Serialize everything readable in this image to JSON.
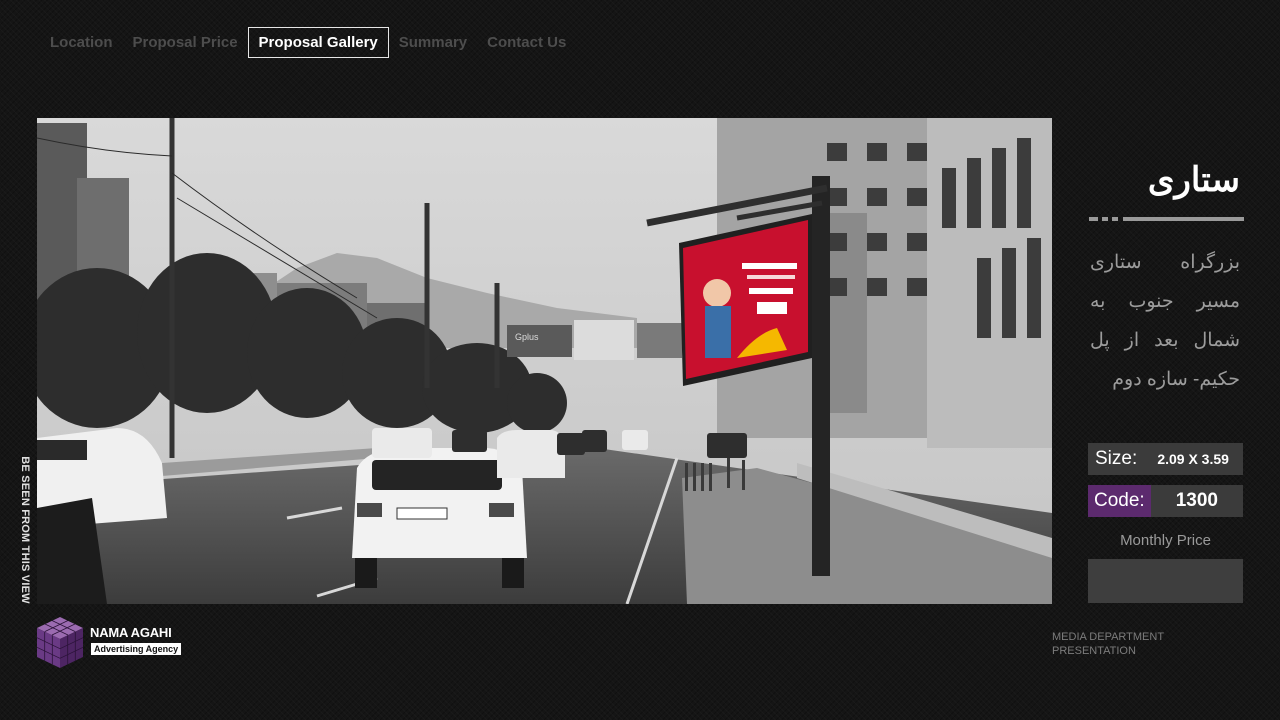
{
  "nav": {
    "items": [
      {
        "label": "Location"
      },
      {
        "label": "Proposal Price"
      },
      {
        "label": "Proposal Gallery"
      },
      {
        "label": "Summary"
      },
      {
        "label": "Contact Us"
      }
    ],
    "active_index": 2
  },
  "photo": {
    "vertical_caption": "BE SEEN FROM THIS VIEW",
    "billboard_sign_text": "Gplus"
  },
  "location": {
    "title": "ستاری",
    "description": "بزرگراه ستاری مسیر جنوب به شمال بعد از پل حکیم- سازه دوم"
  },
  "specs": {
    "size_label": "Size:",
    "size_value": "2.09 X 3.59",
    "code_label": "Code:",
    "code_value": "1300",
    "monthly_price_label": "Monthly Price",
    "monthly_price_value": ""
  },
  "footer": {
    "logo_name": "NAMA AGAHI",
    "logo_tagline": "Advertising Agency",
    "presentation_line1": "MEDIA DEPARTMENT",
    "presentation_line2": "PRESENTATION"
  },
  "colors": {
    "background": "#151515",
    "accent_purple": "#5c2a6e",
    "billboard_red": "#c8102e",
    "spec_box": "#3b3b3b"
  }
}
